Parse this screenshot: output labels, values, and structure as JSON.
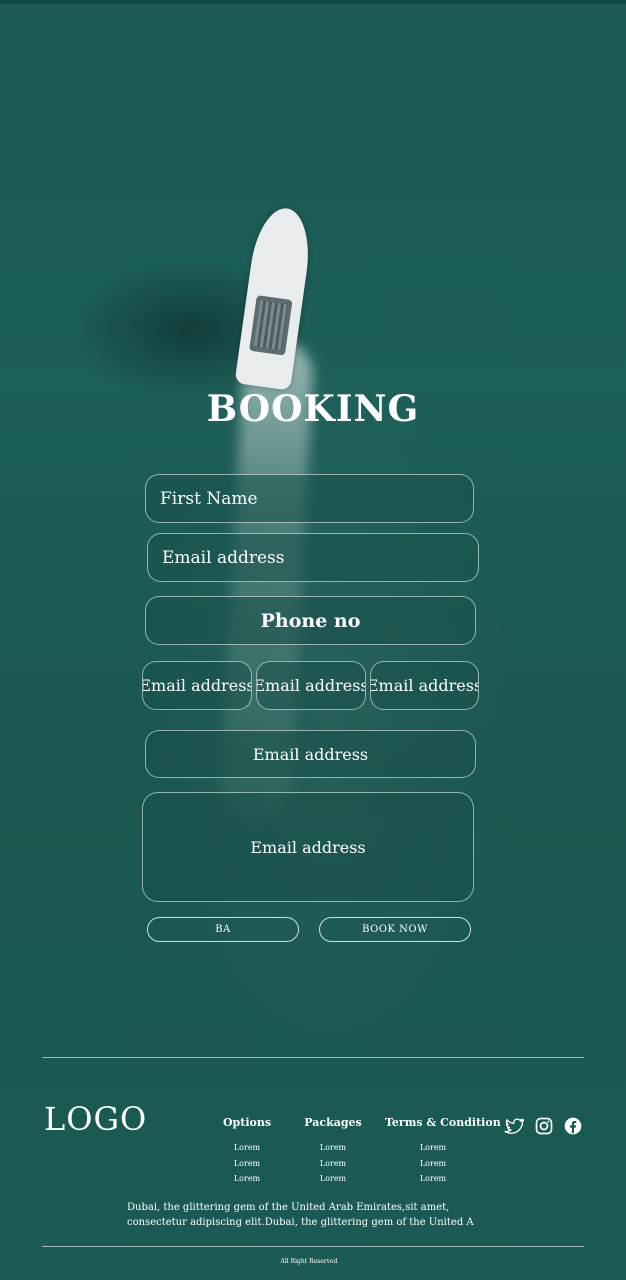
{
  "booking": {
    "title": "BOOKING",
    "first_name_placeholder": "First Name",
    "email_placeholder": "Email address",
    "phone_placeholder": "Phone no",
    "field_a": "Email address",
    "field_b": "Email address",
    "field_c": "Email address",
    "field_d": "Email address",
    "message_placeholder": "Email address",
    "back_button": "BA",
    "book_button": "BOOK NOW"
  },
  "footer": {
    "logo": "LOGO",
    "columns": [
      {
        "heading": "Options",
        "items": [
          "Lorem",
          "Lorem",
          "Lorem"
        ]
      },
      {
        "heading": "Packages",
        "items": [
          "Lorem",
          "Lorem",
          "Lorem"
        ]
      },
      {
        "heading": "Terms & Condition",
        "items": [
          "Lorem",
          "Lorem",
          "Lorem"
        ]
      }
    ],
    "social_icons": [
      "twitter-icon",
      "instagram-icon",
      "facebook-icon"
    ],
    "description": "Dubai, the glittering gem of the United Arab Emirates,sit amet, consectetur adipiscing elit.Dubai, the glittering gem of the United A",
    "rights": "All Right Reserved"
  },
  "colors": {
    "background": "#1a5650",
    "text": "#ffffff"
  }
}
